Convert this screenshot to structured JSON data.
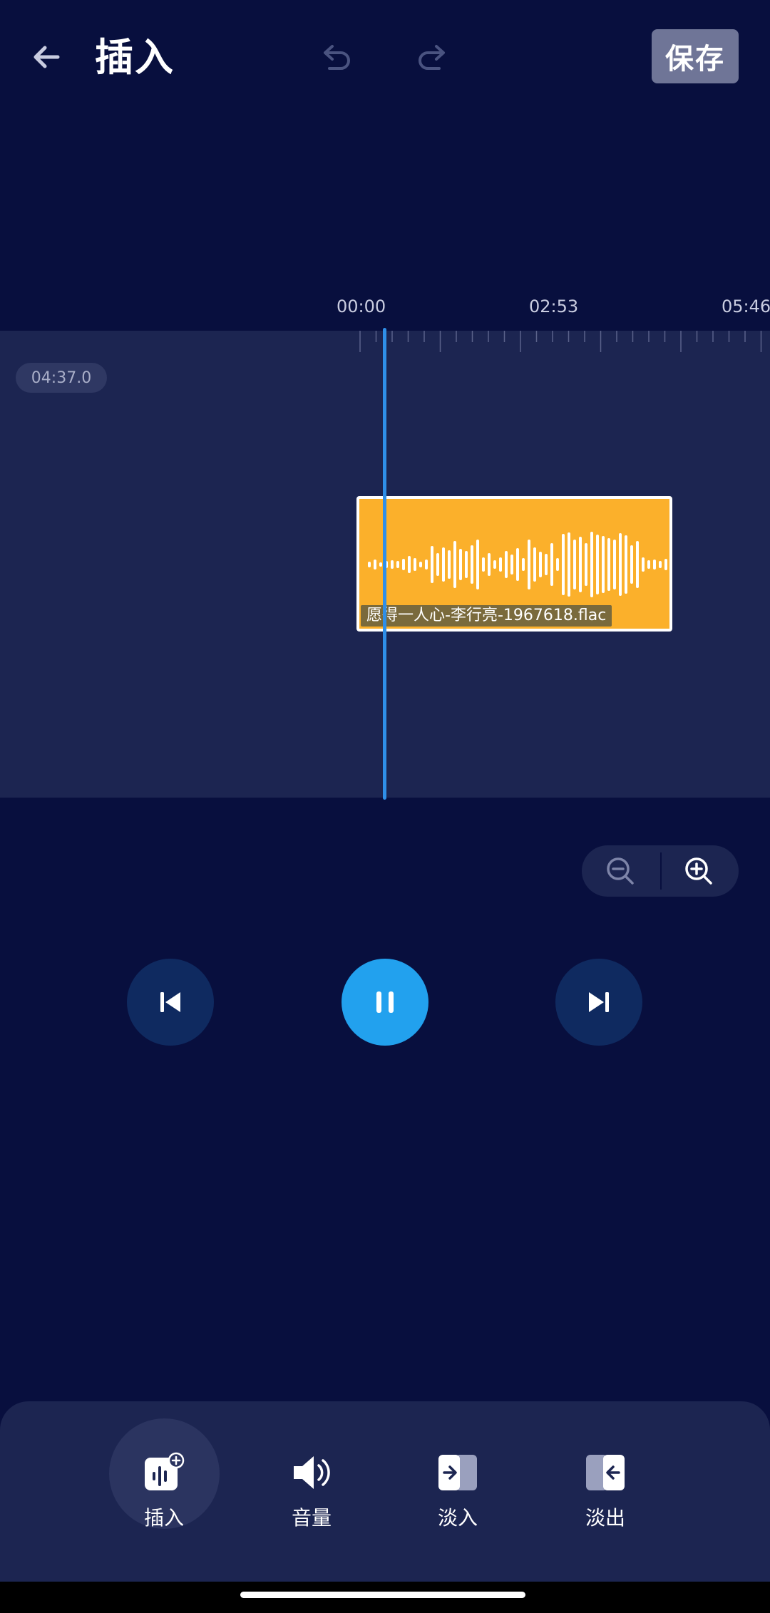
{
  "header": {
    "title": "插入",
    "save_label": "保存"
  },
  "ruler": {
    "labels": [
      "00:00",
      "02:53",
      "05:46"
    ]
  },
  "timeline": {
    "duration": "04:37.0",
    "clip_name": "愿得一人心-李行亮-1967618.flac"
  },
  "toolbar": {
    "items": [
      {
        "label": "插入",
        "icon": "insert-audio-icon",
        "active": true
      },
      {
        "label": "音量",
        "icon": "volume-icon",
        "active": false
      },
      {
        "label": "淡入",
        "icon": "fade-in-icon",
        "active": false
      },
      {
        "label": "淡出",
        "icon": "fade-out-icon",
        "active": false
      }
    ]
  },
  "colors": {
    "background": "#080f3e",
    "panel": "#1c2551",
    "clip": "#fbb02b",
    "playhead": "#2f8fe8",
    "play_button": "#22a1ee"
  }
}
